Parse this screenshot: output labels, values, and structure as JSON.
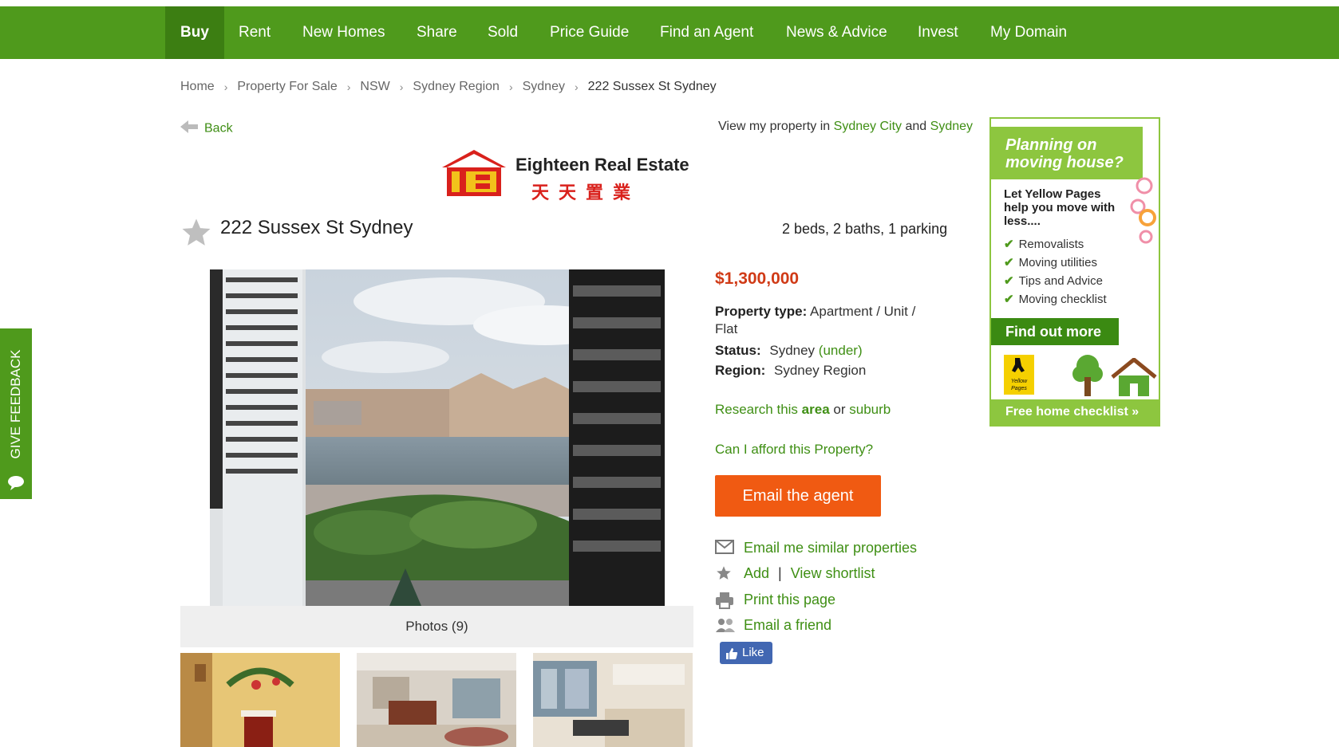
{
  "nav": {
    "items": [
      "Buy",
      "Rent",
      "New Homes",
      "Share",
      "Sold",
      "Price Guide",
      "Find an Agent",
      "News & Advice",
      "Invest",
      "My Domain"
    ],
    "active": "Buy"
  },
  "breadcrumb": [
    "Home",
    "Property For Sale",
    "NSW",
    "Sydney Region",
    "Sydney",
    "222 Sussex St Sydney"
  ],
  "back_label": "Back",
  "view_my": {
    "prefix": "View my property in",
    "link1": "Sydney City",
    "and": "and",
    "link2": "Sydney"
  },
  "agency": {
    "name": "Eighteen Real Estate",
    "chinese": "天天置業"
  },
  "listing": {
    "title": "222 Sussex St Sydney",
    "features": "2 beds, 2 baths, 1 parking",
    "price": "$1,300,000",
    "property_type_label": "Property type:",
    "property_type_value": "Apartment / Unit /",
    "property_type_value2": "Flat",
    "status_label": "Status:",
    "status_value": "Sydney",
    "status_link": "(under)",
    "region_label": "Region:",
    "region_value": "Sydney Region"
  },
  "research": {
    "prefix": "Research this",
    "area": "area",
    "or": "or",
    "suburb": "suburb"
  },
  "afford_link": "Can I afford this Property?",
  "email_agent_label": "Email the agent",
  "actions": {
    "email_similar": "Email me similar properties",
    "add": "Add",
    "sep": "|",
    "view_shortlist": "View shortlist",
    "print": "Print this page",
    "email_friend": "Email a friend"
  },
  "like_label": "Like",
  "photos_label": "Photos (9)",
  "feedback_label": "GIVE FEEDBACK",
  "ad": {
    "headline_1": "Planning on",
    "headline_2": "moving house?",
    "sub": "Let Yellow Pages help you move with less....",
    "items": [
      "Removalists",
      "Moving utilities",
      "Tips and Advice",
      "Moving checklist"
    ],
    "button": "Find out more",
    "footer": "Free home checklist »",
    "yp_logo_text": "Yellow Pages"
  },
  "colors": {
    "nav_green": "#4f9a1c",
    "nav_active": "#3c7e12",
    "link_green": "#3f8f14",
    "price_red": "#d03a16",
    "cta_orange": "#f05a12",
    "ad_green": "#8dc63f"
  }
}
